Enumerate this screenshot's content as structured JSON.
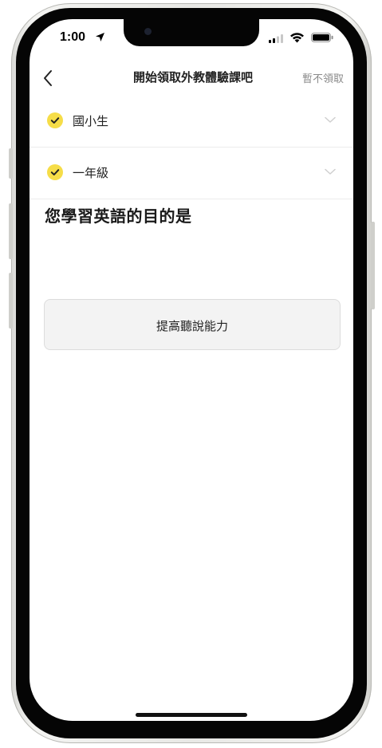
{
  "status_bar": {
    "time": "1:00",
    "icons": [
      "location-arrow-icon",
      "signal-icon",
      "wifi-icon",
      "battery-icon"
    ]
  },
  "nav": {
    "back_icon": "chevron-left-icon",
    "title": "開始領取外教體驗課吧",
    "skip_label": "暫不領取"
  },
  "selections": [
    {
      "label": "國小生",
      "checked": true,
      "icon": "check-icon",
      "chevron": "chevron-down-icon"
    },
    {
      "label": "一年級",
      "checked": true,
      "icon": "check-icon",
      "chevron": "chevron-down-icon"
    }
  ],
  "question": {
    "heading": "您學習英語的目的是"
  },
  "options": [
    {
      "label": "提高聽說能力"
    }
  ],
  "colors": {
    "accent_yellow": "#f6dd48",
    "text_primary": "#222222",
    "text_muted": "#8a8a8a",
    "card_bg": "#f3f3f3",
    "divider": "#ececec"
  }
}
